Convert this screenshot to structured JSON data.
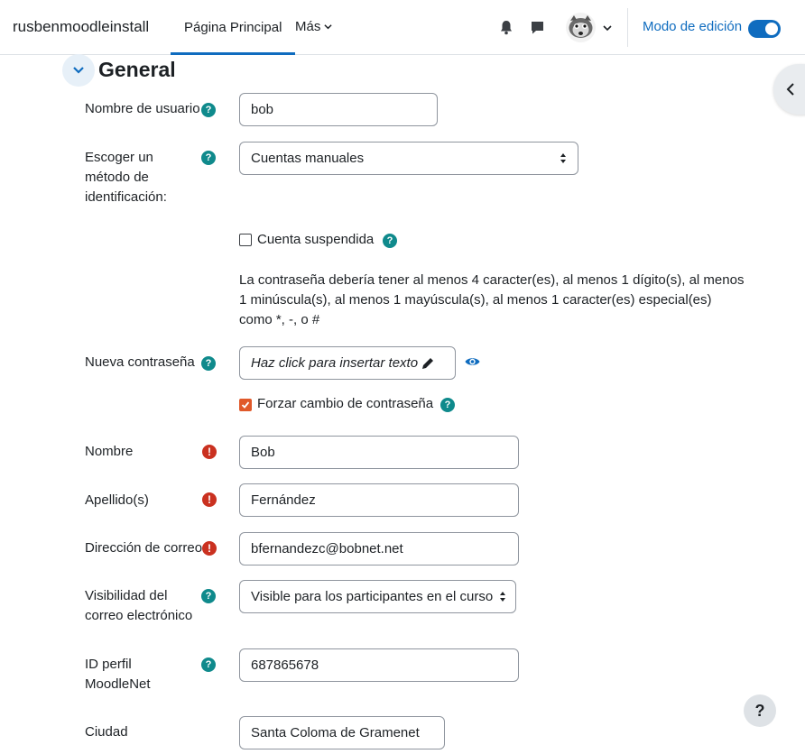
{
  "navbar": {
    "brand": "rusbenmoodleinstall",
    "home_label": "Página Principal",
    "more_label": "Más",
    "edit_mode_label": "Modo de edición",
    "edit_mode_on": true,
    "accent_color": "#0f6cbf"
  },
  "section": {
    "title": "General"
  },
  "form": {
    "username": {
      "label": "Nombre de usuario",
      "value": "bob"
    },
    "auth_method": {
      "label_line1": "Escoger un",
      "label_line2": "método de",
      "label_line3": "identificación:",
      "value": "Cuentas manuales"
    },
    "suspended": {
      "label": "Cuenta suspendida",
      "checked": false
    },
    "password_note_line1": "La contraseña debería tener al menos 4 caracter(es), al menos 1 dígito(s), al menos",
    "password_note_line2": "1 minúscula(s), al menos 1 mayúscula(s), al menos 1 caracter(es) especial(es)",
    "password_note_line3": "como *, -, o #",
    "new_password": {
      "label": "Nueva contraseña",
      "placeholder": "Haz click para insertar texto"
    },
    "force_change": {
      "label": "Forzar cambio de contraseña",
      "checked": true
    },
    "firstname": {
      "label": "Nombre",
      "value": "Bob"
    },
    "lastname": {
      "label": "Apellido(s)",
      "value": "Fernández"
    },
    "email": {
      "label": "Dirección de correo",
      "value": "bfernandezc@bobnet.net"
    },
    "email_visibility": {
      "label_line1": "Visibilidad del",
      "label_line2": "correo electrónico",
      "value": "Visible para los participantes en el curso"
    },
    "moodlenet": {
      "label_line1": "ID perfil",
      "label_line2": "MoodleNet",
      "value": "687865678"
    },
    "city": {
      "label": "Ciudad",
      "value": "Santa Coloma de Gramenet"
    }
  },
  "help_fab_label": "?",
  "icons": {
    "help": "question-circle-icon",
    "required": "exclamation-circle-icon"
  }
}
